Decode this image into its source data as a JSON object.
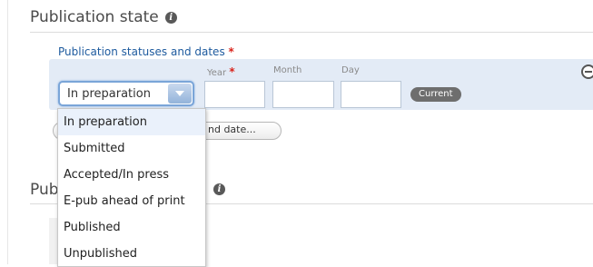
{
  "section": {
    "title": "Publication state",
    "info_icon": "info-icon"
  },
  "field": {
    "label": "Publication statuses and dates",
    "required_mark": "*"
  },
  "columns": {
    "year": "Year",
    "year_required": "*",
    "month": "Month",
    "day": "Day"
  },
  "status_select": {
    "value": "In preparation",
    "options": [
      "In preparation",
      "Submitted",
      "Accepted/In press",
      "E-pub ahead of print",
      "Published",
      "Unpublished"
    ]
  },
  "date": {
    "year": "",
    "month": "",
    "day": ""
  },
  "buttons": {
    "current": "Current",
    "add_partial": "nd date..."
  },
  "section2": {
    "title_partial": "Pub",
    "info_icon": "info-icon"
  },
  "colors": {
    "label_blue": "#1d5a9e",
    "required_red": "#d9241c",
    "row_bg": "#e3ebf6",
    "select_border": "#7aa5d8"
  }
}
